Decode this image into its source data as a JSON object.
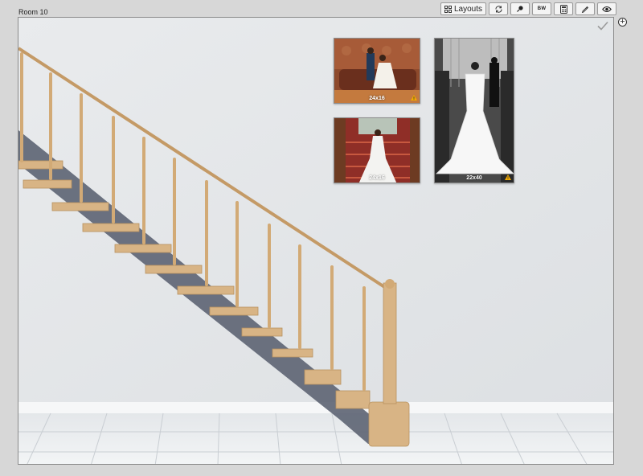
{
  "room": {
    "title": "Room 10"
  },
  "toolbar": {
    "layouts_label": "Layouts",
    "bw_label": "BW",
    "icons": [
      "grid-icon",
      "refresh-icon",
      "pin-icon",
      "calculator-icon",
      "pencil-icon",
      "eye-icon"
    ]
  },
  "frames": [
    {
      "size": "24x16"
    },
    {
      "size": "24x16"
    },
    {
      "size": "22x40"
    }
  ],
  "colors": {
    "wall": "#e6e8ea",
    "floor": "#eef0f2",
    "wood": "#d8b485",
    "steel": "#5f6675",
    "warning": "#f2a900"
  }
}
